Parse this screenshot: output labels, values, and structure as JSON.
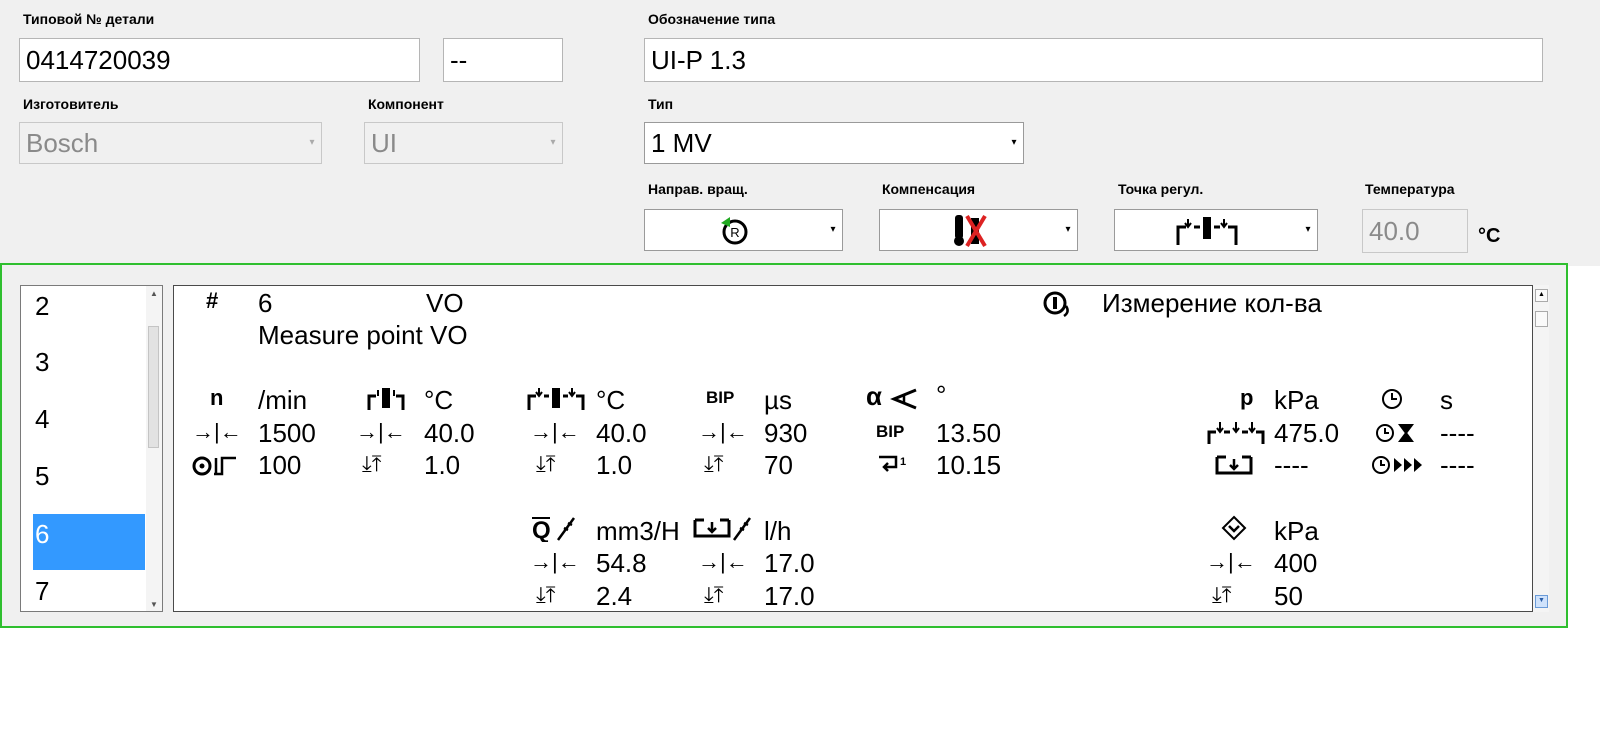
{
  "header": {
    "part_number_label": "Типовой № детали",
    "part_number_value": "0414720039",
    "part_suffix_value": "--",
    "type_designation_label": "Обозначение типа",
    "type_designation_value": "UI-P 1.3",
    "manufacturer_label": "Изготовитель",
    "manufacturer_value": "Bosch",
    "component_label": "Компонент",
    "component_value": "UI",
    "type_label": "Тип",
    "type_value": "1 MV",
    "rotation_label": "Направ. вращ.",
    "compensation_label": "Компенсация",
    "control_point_label": "Точка регул.",
    "temperature_label": "Температура",
    "temperature_value": "40.0",
    "temperature_unit": "°C"
  },
  "steps": {
    "items": [
      "2",
      "3",
      "4",
      "5",
      "6",
      "7"
    ],
    "selected": "6"
  },
  "detail": {
    "hash": "#",
    "step_number": "6",
    "step_code": "VO",
    "step_name": "Measure point VO",
    "mode_label": "Измерение кол-ва",
    "speed": {
      "symbol": "n",
      "unit": "/min",
      "setpoint": "1500",
      "tolerance": "100"
    },
    "temp1": {
      "unit": "°C",
      "setpoint": "40.0",
      "tolerance": "1.0"
    },
    "temp2": {
      "unit": "°C",
      "setpoint": "40.0",
      "tolerance": "1.0"
    },
    "bip": {
      "label": "BIP",
      "unit": "µs",
      "setpoint": "930",
      "tolerance": "70"
    },
    "angle": {
      "symbol": "α",
      "unit": "°",
      "bip_label": "BIP",
      "bip_value": "13.50",
      "value2": "10.15"
    },
    "pressure": {
      "symbol": "p",
      "unit": "kPa",
      "value1": "475.0",
      "value2": "----"
    },
    "time": {
      "unit": "s",
      "value1": "----",
      "value2": "----"
    },
    "quantity": {
      "unit": "mm3/H",
      "setpoint": "54.8",
      "tolerance": "2.4"
    },
    "flow": {
      "unit": "l/h",
      "setpoint": "17.0",
      "tolerance": "17.0"
    },
    "pressure2": {
      "unit": "kPa",
      "setpoint": "400",
      "tolerance": "50"
    }
  },
  "colors": {
    "selection": "#3399ff",
    "panel_border": "#2fbf2f",
    "accent_green": "#22aa22",
    "accent_red": "#dd2222"
  }
}
